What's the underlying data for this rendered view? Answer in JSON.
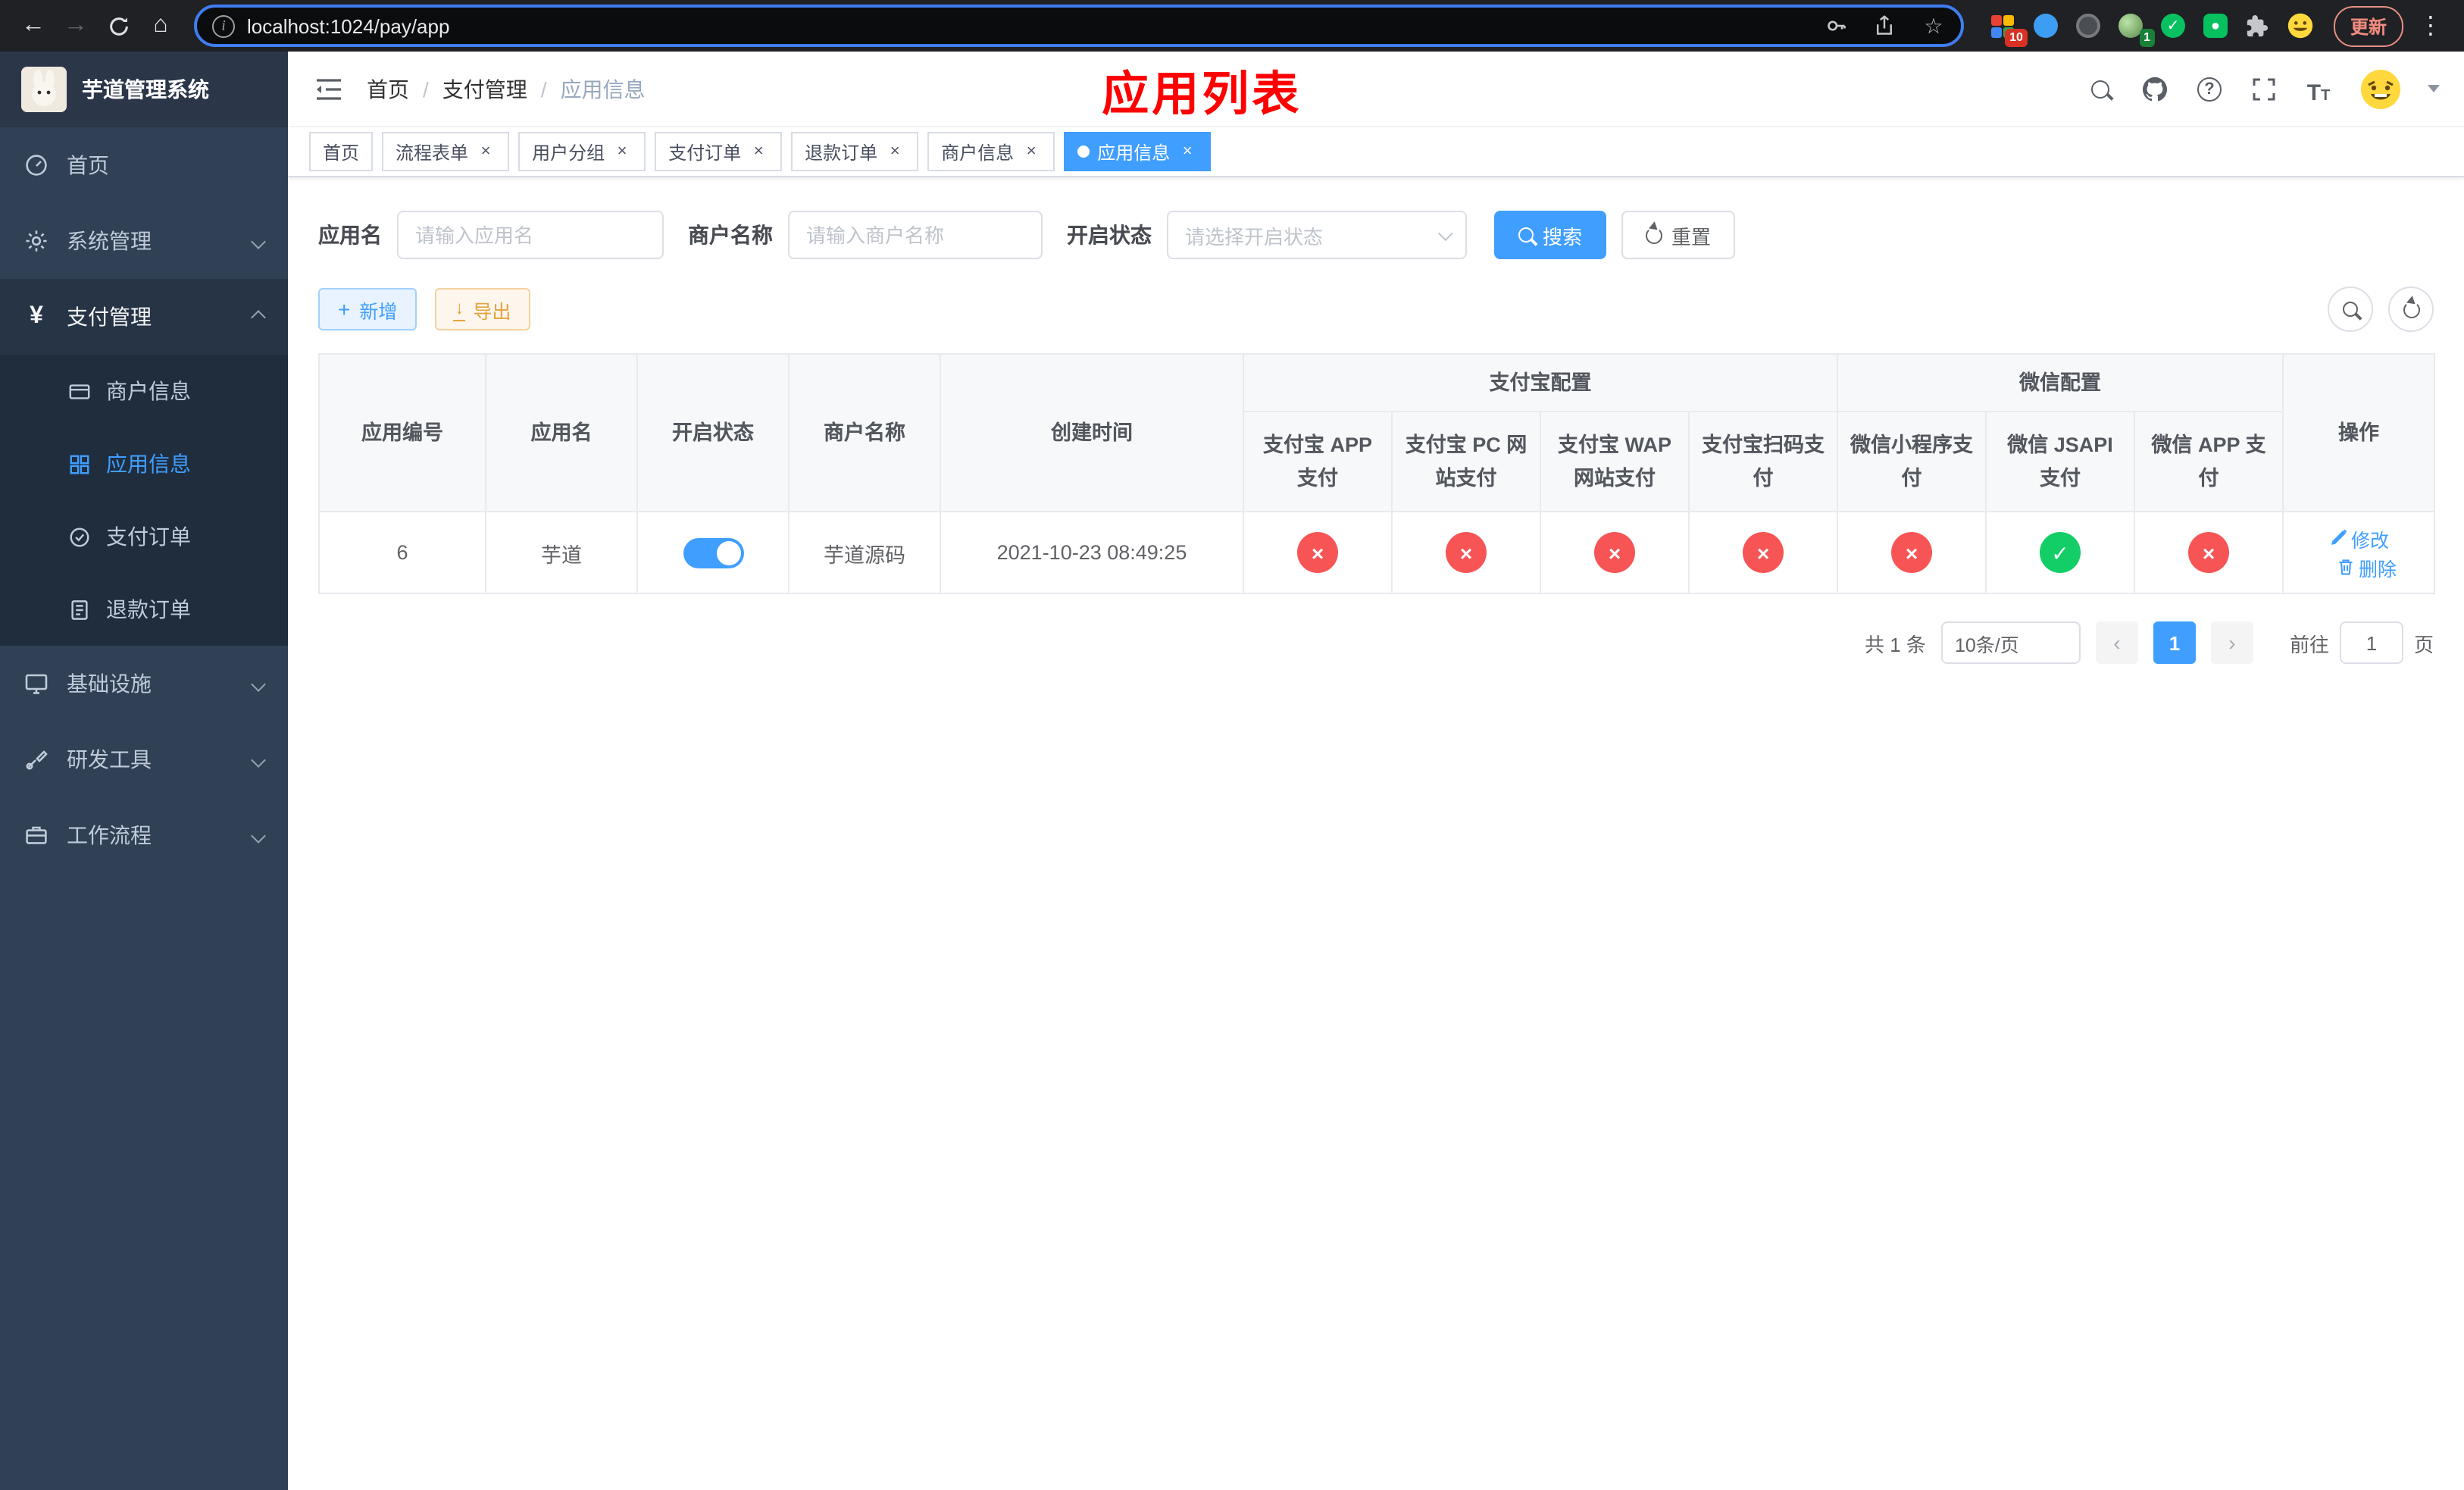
{
  "colors": {
    "primary": "#409eff",
    "success": "#13ce66",
    "danger": "#f75555",
    "warning": "#e6a23c",
    "annotation_red": "#ff0000",
    "sidebar_bg": "#304156",
    "submenu_bg": "#1f2d3d"
  },
  "browser": {
    "url": "localhost:1024/pay/app",
    "update_label": "更新",
    "ext_badges": {
      "grid": "10",
      "avatar": "1"
    }
  },
  "sidebar": {
    "logo_title": "芋道管理系统",
    "home": "首页",
    "system": "系统管理",
    "payment": "支付管理",
    "merchant_info": "商户信息",
    "app_info": "应用信息",
    "pay_order": "支付订单",
    "refund_order": "退款订单",
    "infra": "基础设施",
    "devtools": "研发工具",
    "workflow": "工作流程"
  },
  "navbar": {
    "breadcrumb": [
      "首页",
      "支付管理",
      "应用信息"
    ],
    "overlay_title": "应用列表"
  },
  "tabs": [
    {
      "label": "首页"
    },
    {
      "label": "流程表单"
    },
    {
      "label": "用户分组"
    },
    {
      "label": "支付订单"
    },
    {
      "label": "退款订单"
    },
    {
      "label": "商户信息"
    },
    {
      "label": "应用信息"
    }
  ],
  "filters": {
    "app_name_label": "应用名",
    "app_name_placeholder": "请输入应用名",
    "merchant_label": "商户名称",
    "merchant_placeholder": "请输入商户名称",
    "status_label": "开启状态",
    "status_placeholder": "请选择开启状态",
    "search_label": "搜索",
    "reset_label": "重置"
  },
  "toolbar": {
    "add_label": "新增",
    "export_label": "导出"
  },
  "table": {
    "groups": {
      "alipay": "支付宝配置",
      "wechat": "微信配置"
    },
    "columns": [
      "应用编号",
      "应用名",
      "开启状态",
      "商户名称",
      "创建时间",
      "支付宝 APP 支付",
      "支付宝 PC 网站支付",
      "支付宝 WAP 网站支付",
      "支付宝扫码支付",
      "微信小程序支付",
      "微信 JSAPI 支付",
      "微信 APP 支付",
      "操作"
    ],
    "rows": [
      {
        "id": "6",
        "name": "芋道",
        "enabled": true,
        "merchant": "芋道源码",
        "created": "2021-10-23 08:49:25",
        "channels": [
          false,
          false,
          false,
          false,
          false,
          true,
          false
        ],
        "edit_label": "修改",
        "delete_label": "删除"
      }
    ]
  },
  "pagination": {
    "total": "共 1 条",
    "page_size": "10条/页",
    "page": "1",
    "goto_label": "前往",
    "goto_value": "1",
    "goto_unit": "页"
  }
}
